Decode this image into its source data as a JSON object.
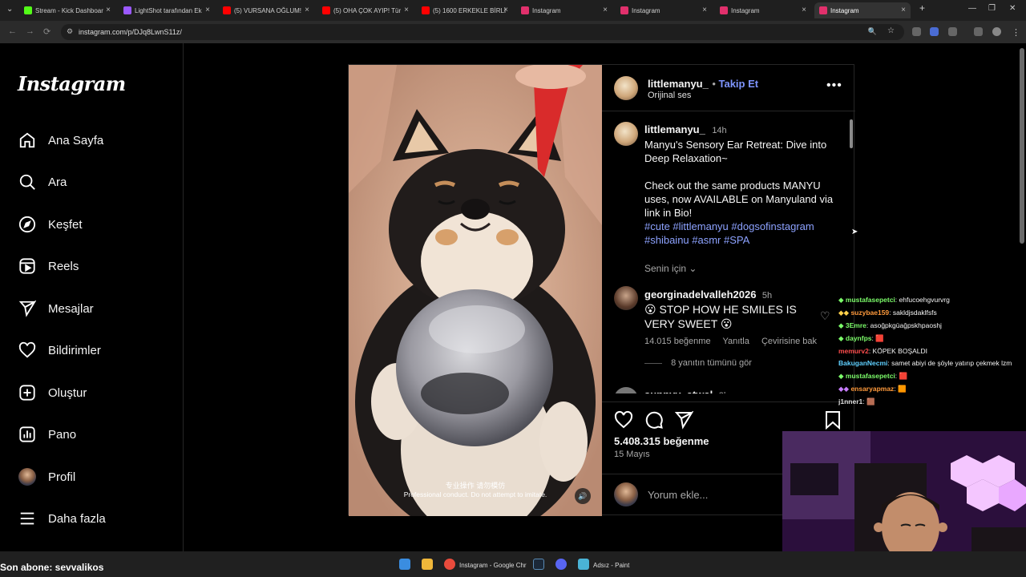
{
  "browser": {
    "tabs": [
      {
        "label": "Stream - Kick Dashboar",
        "color": "#53fc18"
      },
      {
        "label": "LightShot tarafından Ek",
        "color": "#9b59ff"
      },
      {
        "label": "(5) VURSANA OĞLUM!",
        "color": "#ff0000"
      },
      {
        "label": "(5) OHA ÇOK AYIP! Tür",
        "color": "#ff0000"
      },
      {
        "label": "(5) 1600 ERKEKLE BİRLİ",
        "color": "#ff0000"
      },
      {
        "label": "Instagram",
        "color": "#e1306c"
      },
      {
        "label": "Instagram",
        "color": "#e1306c"
      },
      {
        "label": "Instagram",
        "color": "#e1306c"
      },
      {
        "label": "Instagram",
        "color": "#e1306c"
      }
    ],
    "url": "instagram.com/p/DJq8LwnS11z/"
  },
  "sidebar": {
    "logo": "Instagram",
    "items": [
      {
        "label": "Ana Sayfa",
        "icon": "home-icon"
      },
      {
        "label": "Ara",
        "icon": "search-icon"
      },
      {
        "label": "Keşfet",
        "icon": "compass-icon"
      },
      {
        "label": "Reels",
        "icon": "reels-icon"
      },
      {
        "label": "Mesajlar",
        "icon": "send-icon"
      },
      {
        "label": "Bildirimler",
        "icon": "heart-icon"
      },
      {
        "label": "Oluştur",
        "icon": "plus-square-icon"
      },
      {
        "label": "Pano",
        "icon": "dashboard-icon"
      },
      {
        "label": "Profil",
        "icon": "avatar"
      },
      {
        "label": "Daha fazla",
        "icon": "menu-icon"
      }
    ]
  },
  "post": {
    "username": "littlemanyu_",
    "follow_label": "Takip Et",
    "audio": "Orijinal ses",
    "video_subtitle_cn": "专业操作 请勿模仿",
    "video_subtitle_en": "Professional conduct. Do not attempt to imitate.",
    "caption": {
      "username": "littlemanyu_",
      "time": "14h",
      "line1": "Manyu's Sensory Ear Retreat: Dive into Deep Relaxation~",
      "line2": "Check out the same products MANYU uses, now AVAILABLE on Manyuland via link in Bio!",
      "tags1": "#cute #littlemanyu #dogsofinstagram",
      "tags2": "#shibainu #asmr #SPA",
      "senin_icin": "Senin için"
    },
    "comment1": {
      "username": "georginadelvalleh2026",
      "time": "5h",
      "text": "😮 STOP HOW HE SMILES IS VERY SWEET 😮",
      "likes": "14.015 beğenme",
      "reply": "Yanıtla",
      "translate": "Çevirisine bak",
      "view_replies": "8 yanıtın tümünü gör"
    },
    "comment2": {
      "username": "sunnyy_atwal",
      "time": "3h"
    },
    "likes": "5.408.315 beğenme",
    "date": "15 Mayıs",
    "add_comment_placeholder": "Yorum ekle..."
  },
  "chat": [
    {
      "user": "mustafasepetci",
      "msg": ": ehfucoehgvurvrg",
      "color": "#7cfc6a"
    },
    {
      "user": "suzybae159",
      "msg": ": sakldjsdaklfsfs",
      "color": "#ff9a3c"
    },
    {
      "user": "3Emre",
      "msg": ": asoğpkgüağpskhpaoshj",
      "color": "#7cfc6a"
    },
    {
      "user": "daynfps",
      "msg": ": 🟥",
      "color": "#7cfc6a"
    },
    {
      "user": "memurv2",
      "msg": ": KÖPEK BOŞALDI",
      "color": "#ff4d4d"
    },
    {
      "user": "BakuganNecmi",
      "msg": ": samet abiyi de şöyle yatırıp çekmek lzm",
      "color": "#5fd0ff"
    },
    {
      "user": "mustafasepetci",
      "msg": ": 🟥",
      "color": "#7cfc6a"
    },
    {
      "user": "ensaryapmaz",
      "msg": ": 🟧",
      "color": "#ff9a3c"
    },
    {
      "user": "j1nner1",
      "msg": ": 🟫",
      "color": "#dddddd"
    }
  ],
  "overlay": {
    "last_sub": "Son abone: sevvalikos"
  },
  "taskbar": {
    "chrome_label": "Instagram - Google Chr",
    "paint_label": "Adsız - Paint"
  }
}
